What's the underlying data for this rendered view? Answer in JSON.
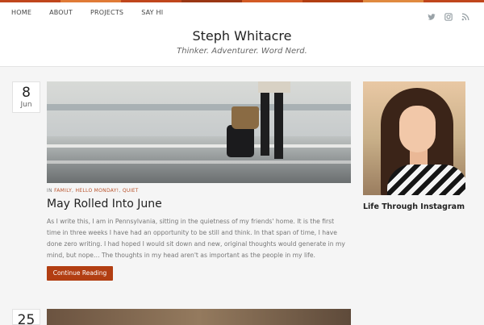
{
  "colors": {
    "accent": "#b23e12",
    "stripe": [
      "#c0461c",
      "#e07b37",
      "#c0461c",
      "#9a3714",
      "#d35b25",
      "#b23e12",
      "#e08a3f",
      "#c0461c"
    ]
  },
  "nav": {
    "items": [
      {
        "label": "HOME"
      },
      {
        "label": "ABOUT"
      },
      {
        "label": "PROJECTS"
      },
      {
        "label": "SAY HI"
      }
    ]
  },
  "social": {
    "icons": [
      "twitter-icon",
      "instagram-icon",
      "rss-icon"
    ]
  },
  "site": {
    "title": "Steph Whitacre",
    "tagline": "Thinker. Adventurer. Word Nerd."
  },
  "posts": [
    {
      "day": "8",
      "month": "Jun",
      "meta_prefix": "IN",
      "categories": [
        "FAMILY",
        "HELLO MONDAY!",
        "QUIET"
      ],
      "title": "May Rolled Into June",
      "excerpt": "As I write this, I am in Pennsylvania, sitting in the quietness of my friends' home. It is the first time in three weeks I have had an opportunity to be still and think. In that span of time, I have done zero writing. I had hoped I would sit down and new, original thoughts would generate in my mind, but nope… The thoughts in my head aren't as important as the people in my life.",
      "button": "Continue Reading"
    },
    {
      "day": "25"
    }
  ],
  "sidebar": {
    "widget_title": "Life Through Instagram"
  }
}
